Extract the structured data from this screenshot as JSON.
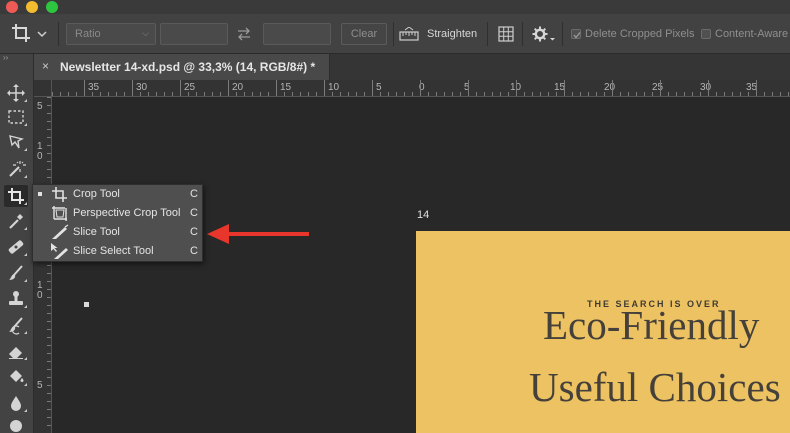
{
  "options_bar": {
    "ratio_label": "Ratio",
    "clear_label": "Clear",
    "straighten_label": "Straighten",
    "delete_cropped_label": "Delete Cropped Pixels",
    "content_aware_label": "Content-Aware"
  },
  "document_tab": {
    "close_glyph": "×",
    "title": "Newsletter 14-xd.psd @ 33,3% (14, RGB/8#) *"
  },
  "rulers": {
    "horizontal": [
      "35",
      "30",
      "25",
      "20",
      "15",
      "10",
      "5",
      "0",
      "5",
      "10",
      "15",
      "20",
      "25",
      "30",
      "35"
    ],
    "vertical": [
      "5",
      "1",
      "0",
      "5",
      "1",
      "0",
      "5"
    ]
  },
  "flyout": {
    "items": [
      {
        "label": "Crop Tool",
        "shortcut": "C",
        "icon": "crop-icon",
        "selected": true
      },
      {
        "label": "Perspective Crop Tool",
        "shortcut": "C",
        "icon": "perspective-crop-icon",
        "selected": false
      },
      {
        "label": "Slice Tool",
        "shortcut": "C",
        "icon": "slice-icon",
        "selected": false
      },
      {
        "label": "Slice Select Tool",
        "shortcut": "C",
        "icon": "slice-select-icon",
        "selected": false
      }
    ]
  },
  "artboard": {
    "label": "14",
    "kicker": "THE SEARCH IS OVER",
    "headline_line1": "Eco-Friendly",
    "headline_line2": "Useful Choices"
  },
  "toolbar": {
    "collapse_glyph": "››",
    "tools": [
      "move-icon",
      "marquee-icon",
      "lasso-icon",
      "magic-wand-icon",
      "crop-icon",
      "eyedropper-icon",
      "healing-icon",
      "brush-icon",
      "stamp-icon",
      "history-brush-icon",
      "eraser-icon",
      "paint-bucket-icon",
      "blur-icon",
      "dodge-icon"
    ]
  },
  "colors": {
    "artboard_bg": "#edc262",
    "headline": "#45413a",
    "arrow": "#e8362c",
    "panel": "#424242",
    "canvas": "#282828"
  }
}
